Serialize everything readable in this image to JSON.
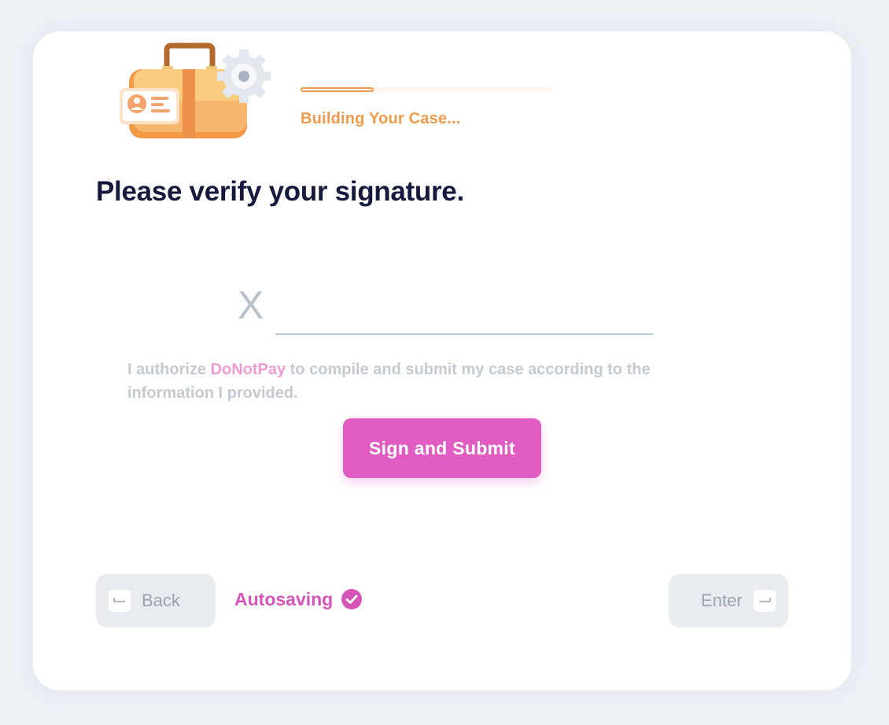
{
  "header": {
    "progress_label": "Building Your Case...",
    "progress_fraction": 0.29
  },
  "main": {
    "title": "Please verify your signature.",
    "signature": {
      "marker": "X",
      "value": ""
    },
    "consent": {
      "prefix": "I authorize ",
      "brand": "DoNotPay",
      "suffix": " to compile and submit my case according to the information I provided."
    },
    "submit_label": "Sign and Submit"
  },
  "footer": {
    "back_label": "Back",
    "autosave_label": "Autosaving",
    "enter_label": "Enter"
  },
  "icons": {
    "illustration": "briefcase-gear-icon",
    "back": "arrow-left-icon",
    "autosave": "check-circle-icon",
    "enter": "arrow-right-icon"
  },
  "colors": {
    "accent": "#e05cc1",
    "progress": "#ee9a4a",
    "title": "#141a3c",
    "muted": "#c3cad4",
    "background": "#eef1f6"
  }
}
